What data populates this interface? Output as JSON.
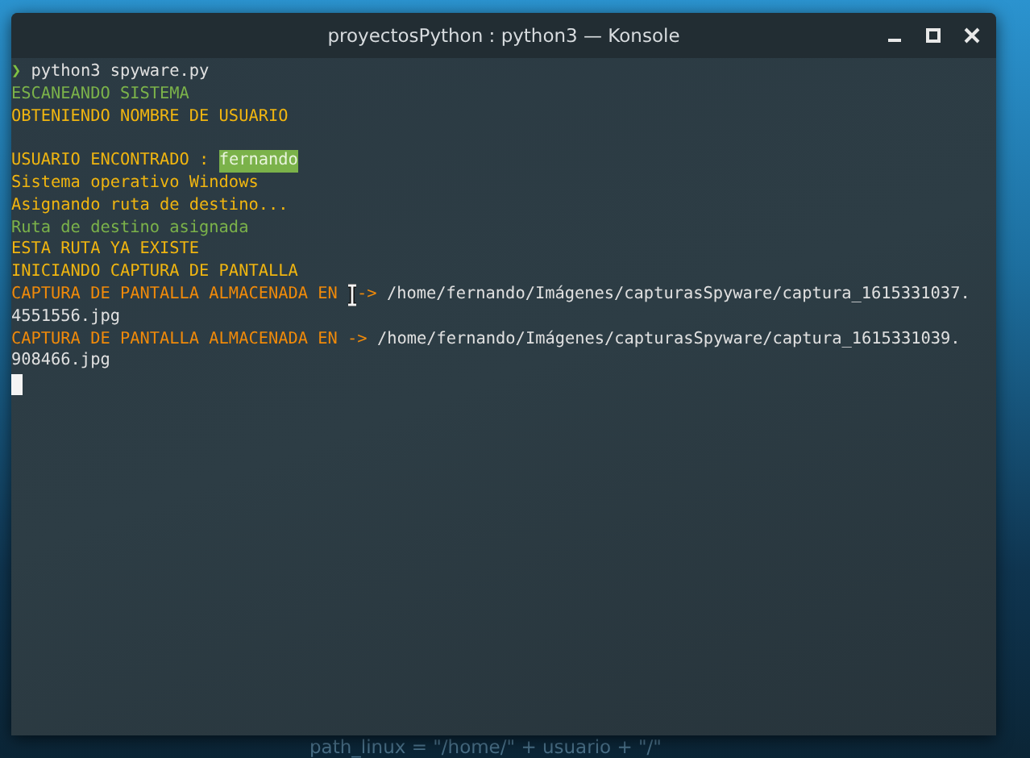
{
  "window": {
    "title": "proyectosPython : python3 — Konsole"
  },
  "terminal": {
    "lines": [
      {
        "kind": "text",
        "segments": [
          {
            "text": "❯",
            "kind": "prompt"
          },
          {
            "text": " python3 spyware.py",
            "kind": "plain"
          }
        ]
      },
      {
        "kind": "text",
        "segments": [
          {
            "text": "ESCANEANDO SISTEMA",
            "kind": "green"
          }
        ]
      },
      {
        "kind": "text",
        "segments": [
          {
            "text": "OBTENIENDO NOMBRE DE USUARIO",
            "kind": "yellow"
          }
        ]
      },
      {
        "kind": "blank"
      },
      {
        "kind": "text",
        "segments": [
          {
            "text": "USUARIO ENCONTRADO : ",
            "kind": "yellow"
          },
          {
            "text": "fernando",
            "kind": "highlight"
          }
        ]
      },
      {
        "kind": "text",
        "segments": [
          {
            "text": "Sistema operativo Windows",
            "kind": "yellow"
          }
        ]
      },
      {
        "kind": "text",
        "segments": [
          {
            "text": "Asignando ruta de destino...",
            "kind": "yellow"
          }
        ]
      },
      {
        "kind": "text",
        "segments": [
          {
            "text": "Ruta de destino asignada",
            "kind": "green"
          }
        ]
      },
      {
        "kind": "text",
        "segments": [
          {
            "text": "ESTA RUTA YA EXISTE",
            "kind": "yellow"
          }
        ]
      },
      {
        "kind": "text",
        "segments": [
          {
            "text": "INICIANDO CAPTURA DE PANTALLA",
            "kind": "yellow"
          }
        ]
      },
      {
        "kind": "text",
        "segments": [
          {
            "text": "CAPTURA DE PANTALLA ALMACENADA EN ",
            "kind": "orange"
          },
          {
            "text": "->",
            "kind": "orange"
          },
          {
            "text": " /home/fernando/Imágenes/capturasSpyware/captura_1615331037.",
            "kind": "plain"
          }
        ]
      },
      {
        "kind": "text",
        "segments": [
          {
            "text": "4551556.jpg",
            "kind": "plain"
          }
        ]
      },
      {
        "kind": "text",
        "segments": [
          {
            "text": "CAPTURA DE PANTALLA ALMACENADA EN -> ",
            "kind": "orange"
          },
          {
            "text": "/home/fernando/Imágenes/capturasSpyware/captura_1615331039.",
            "kind": "plain"
          }
        ]
      },
      {
        "kind": "text",
        "segments": [
          {
            "text": "908466.jpg",
            "kind": "plain"
          }
        ]
      },
      {
        "kind": "cursor"
      }
    ]
  },
  "desktop": {
    "background_text": "path_linux = \"/home/\" + usuario + \"/\""
  }
}
